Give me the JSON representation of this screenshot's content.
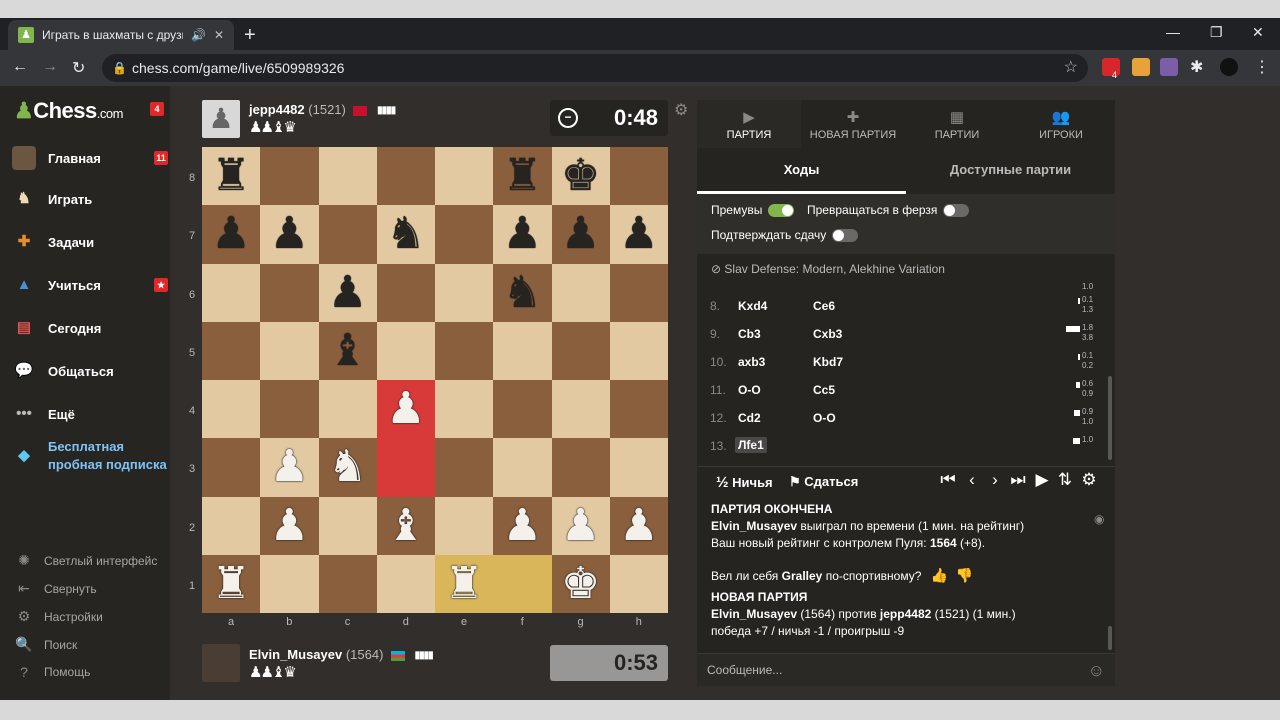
{
  "browser": {
    "tab_title": "Играть в шахматы с друзья",
    "url": "chess.com/game/live/6509989326",
    "badge_count": "4"
  },
  "sidebar": {
    "logo_main": "Chess",
    "logo_suffix": ".com",
    "logo_badge": "4",
    "items": [
      {
        "label": "Главная",
        "icon": "home-avatar-icon",
        "badge": "11"
      },
      {
        "label": "Играть",
        "icon": "play-hand-icon",
        "badge": ""
      },
      {
        "label": "Задачи",
        "icon": "puzzle-icon",
        "badge": ""
      },
      {
        "label": "Учиться",
        "icon": "learn-cap-icon",
        "badge": "★"
      },
      {
        "label": "Сегодня",
        "icon": "news-icon",
        "badge": ""
      },
      {
        "label": "Общаться",
        "icon": "chat-icon",
        "badge": ""
      },
      {
        "label": "Ещё",
        "icon": "more-dots-icon",
        "badge": ""
      }
    ],
    "promo": "Бесплатная пробная подписка",
    "footer": [
      {
        "label": "Светлый интерфейс",
        "icon": "theme-icon"
      },
      {
        "label": "Свернуть",
        "icon": "collapse-icon"
      },
      {
        "label": "Настройки",
        "icon": "settings-icon"
      },
      {
        "label": "Поиск",
        "icon": "search-icon"
      },
      {
        "label": "Помощь",
        "icon": "help-icon"
      }
    ]
  },
  "top_player": {
    "name": "jepp4482",
    "rating": "(1521)",
    "captured": "♟♟♝♛",
    "clock": "0:48",
    "flag_color": "#c8102e"
  },
  "bottom_player": {
    "name": "Elvin_Musayev",
    "rating": "(1564)",
    "captured": "♟♟♝♛",
    "clock": "0:53"
  },
  "board": {
    "files": [
      "a",
      "b",
      "c",
      "d",
      "e",
      "f",
      "g",
      "h"
    ],
    "ranks": [
      "8",
      "7",
      "6",
      "5",
      "4",
      "3",
      "2",
      "1"
    ],
    "light_color": "#e2c9a1",
    "dark_color": "#8a5f3d",
    "highlight_red": "#d83a3a",
    "highlight_yellow": "#d9b65a",
    "pieces": [
      {
        "sq": "a8",
        "p": "♜",
        "c": "b"
      },
      {
        "sq": "f8",
        "p": "♜",
        "c": "b"
      },
      {
        "sq": "g8",
        "p": "♚",
        "c": "b"
      },
      {
        "sq": "a7",
        "p": "♟",
        "c": "b"
      },
      {
        "sq": "b7",
        "p": "♟",
        "c": "b"
      },
      {
        "sq": "d7",
        "p": "♞",
        "c": "b"
      },
      {
        "sq": "f7",
        "p": "♟",
        "c": "b"
      },
      {
        "sq": "g7",
        "p": "♟",
        "c": "b"
      },
      {
        "sq": "h7",
        "p": "♟",
        "c": "b"
      },
      {
        "sq": "c6",
        "p": "♟",
        "c": "b"
      },
      {
        "sq": "f6",
        "p": "♞",
        "c": "b"
      },
      {
        "sq": "c5",
        "p": "♝",
        "c": "b"
      },
      {
        "sq": "d4",
        "p": "♟",
        "c": "w"
      },
      {
        "sq": "b3",
        "p": "♟",
        "c": "w"
      },
      {
        "sq": "c3",
        "p": "♞",
        "c": "w"
      },
      {
        "sq": "b2",
        "p": "♟",
        "c": "w"
      },
      {
        "sq": "d2",
        "p": "♝",
        "c": "w"
      },
      {
        "sq": "f2",
        "p": "♟",
        "c": "w"
      },
      {
        "sq": "g2",
        "p": "♟",
        "c": "w"
      },
      {
        "sq": "h2",
        "p": "♟",
        "c": "w"
      },
      {
        "sq": "a1",
        "p": "♜",
        "c": "w"
      },
      {
        "sq": "e1",
        "p": "♜",
        "c": "w"
      },
      {
        "sq": "g1",
        "p": "♚",
        "c": "w"
      }
    ],
    "highlights": [
      {
        "sq": "d4",
        "type": "red"
      },
      {
        "sq": "d3",
        "type": "red"
      },
      {
        "sq": "e1",
        "type": "yellow"
      },
      {
        "sq": "f1",
        "type": "yellow"
      }
    ]
  },
  "panel": {
    "tabs": [
      {
        "label": "ПАРТИЯ",
        "icon": "game-icon"
      },
      {
        "label": "НОВАЯ ПАРТИЯ",
        "icon": "plus-icon"
      },
      {
        "label": "ПАРТИИ",
        "icon": "board-icon"
      },
      {
        "label": "ИГРОКИ",
        "icon": "players-icon"
      }
    ],
    "subtabs": [
      "Ходы",
      "Доступные партии"
    ],
    "settings": {
      "premoves": "Премувы",
      "auto_queen": "Превращаться в ферзя",
      "confirm_resign": "Подтверждать сдачу"
    },
    "opening": "Slav Defense: Modern, Alekhine Variation",
    "eval_top": "1.0",
    "moves": [
      {
        "n": "8.",
        "w": "Kxd4",
        "b": "Ce6",
        "e1": "0.1",
        "e2": "1.3",
        "bar": 2
      },
      {
        "n": "9.",
        "w": "Cb3",
        "b": "Cxb3",
        "e1": "1.8",
        "e2": "3.8",
        "bar": 14
      },
      {
        "n": "10.",
        "w": "axb3",
        "b": "Kbd7",
        "e1": "0.1",
        "e2": "0.2",
        "bar": 2
      },
      {
        "n": "11.",
        "w": "O-O",
        "b": "Cc5",
        "e1": "0.6",
        "e2": "0.9",
        "bar": 4
      },
      {
        "n": "12.",
        "w": "Cd2",
        "b": "O-O",
        "e1": "0.9",
        "e2": "1.0",
        "bar": 6
      },
      {
        "n": "13.",
        "w": "Лfe1",
        "b": "",
        "e1": "1.0",
        "e2": "",
        "bar": 7
      }
    ],
    "draw": "Ничья",
    "draw_prefix": "½",
    "resign": "Сдаться",
    "log": {
      "over_title": "ПАРТИЯ ОКОНЧЕНА",
      "winner": "Elvin_Musayev",
      "win_text": "выиграл по времени (1 мин. на рейтинг)",
      "rating_text": "Ваш новый рейтинг с контролем Пуля:",
      "rating_value": "1564",
      "rating_delta": "(+8).",
      "sports_q_name": "Gralley",
      "sports_q_prefix": "Вел ли себя",
      "sports_q_suffix": "по-спортивному?",
      "new_title": "НОВАЯ ПАРТИЯ",
      "new_p1": "Elvin_Musayev",
      "new_p1_rating": "(1564)",
      "vs": "против",
      "new_p2": "jepp4482",
      "new_p2_rating": "(1521) (1 мин.)",
      "stats": "победа +7 / ничья -1 / проигрыш -9"
    },
    "message_placeholder": "Сообщение..."
  }
}
